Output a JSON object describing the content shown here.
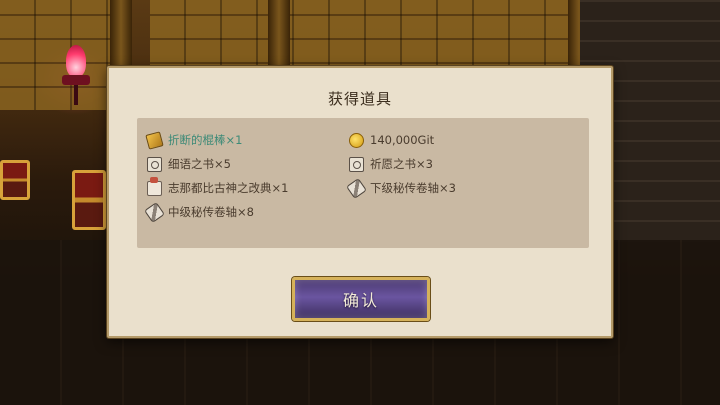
{
  "dialog": {
    "title": "获得道具",
    "items": [
      {
        "label": "折断的棍棒×1",
        "icon": "broken-stick-icon",
        "highlight": true
      },
      {
        "label": "140,000Git",
        "icon": "gold-coin-icon",
        "highlight": false
      },
      {
        "label": "细语之书×5",
        "icon": "book-icon",
        "highlight": false
      },
      {
        "label": "祈愿之书×3",
        "icon": "book-icon",
        "highlight": false
      },
      {
        "label": "志那都比古神之改典×1",
        "icon": "codex-icon",
        "highlight": false
      },
      {
        "label": "下级秘传卷轴×3",
        "icon": "scroll-icon",
        "highlight": false
      },
      {
        "label": "中级秘传卷轴×8",
        "icon": "scroll-icon",
        "highlight": false
      }
    ],
    "confirm_label": "确认"
  },
  "colors": {
    "highlight_text": "#3d8a77",
    "dialog_bg": "#eae0cc",
    "panel_bg": "#c9b9a3",
    "button_purple": "#4c3a72",
    "button_border": "#d6b25a"
  }
}
